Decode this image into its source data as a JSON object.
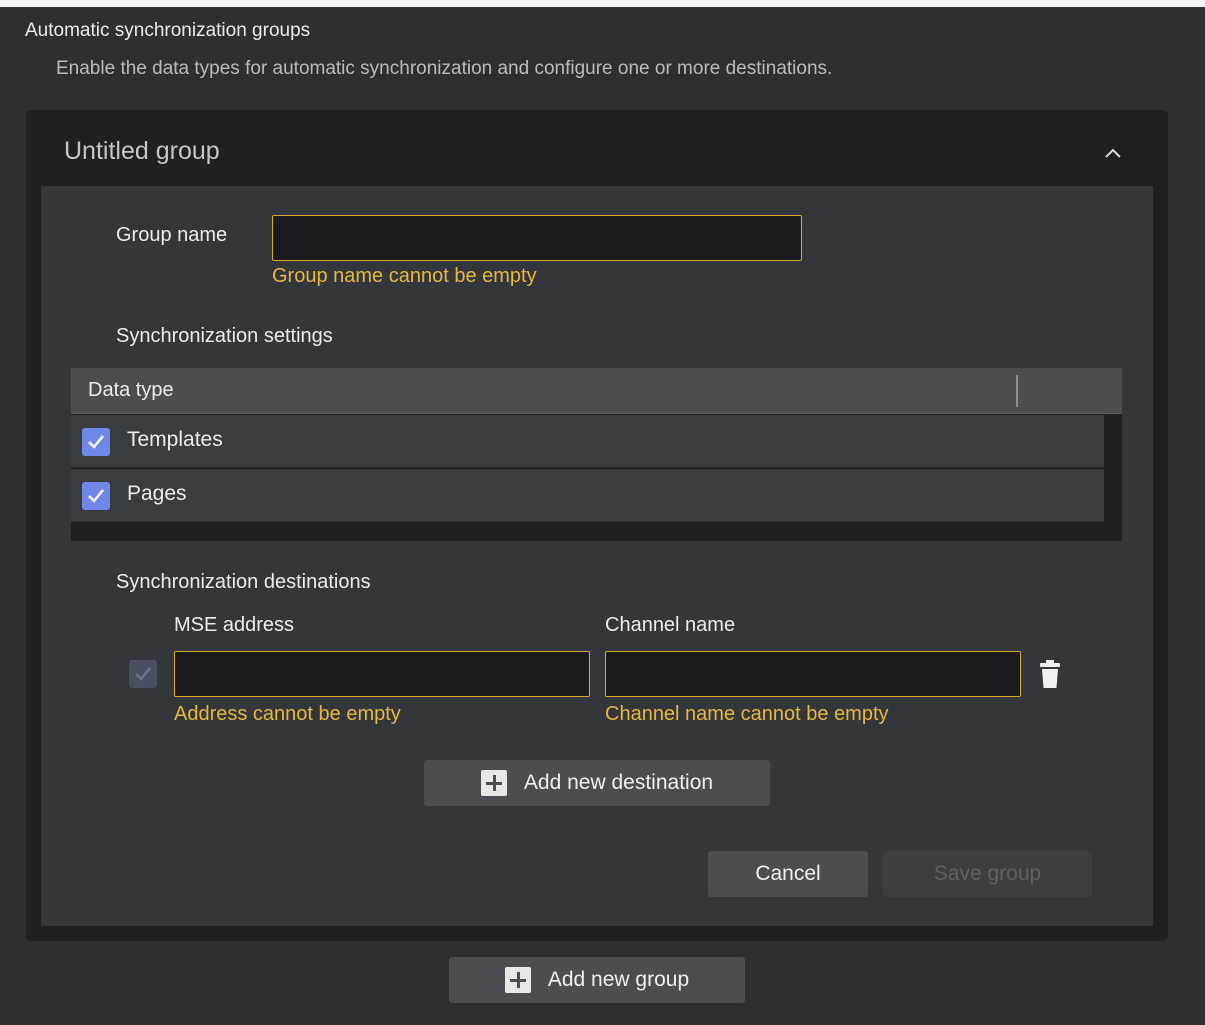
{
  "section": {
    "title": "Automatic synchronization groups",
    "description": "Enable the data types for automatic synchronization and configure one or more destinations."
  },
  "group": {
    "title": "Untitled group",
    "collapse_icon": "chevron-up-icon",
    "name_label": "Group name",
    "name_value": "",
    "name_error": "Group name cannot be empty",
    "sync_settings_label": "Synchronization settings",
    "data_table": {
      "header": "Data type",
      "rows": [
        {
          "label": "Templates",
          "checked": true
        },
        {
          "label": "Pages",
          "checked": true
        }
      ]
    },
    "destinations_label": "Synchronization destinations",
    "mse_address_label": "MSE address",
    "channel_name_label": "Channel name",
    "destination": {
      "enabled": true,
      "address_value": "",
      "channel_value": "",
      "address_error": "Address cannot be empty",
      "channel_error": "Channel name cannot be empty",
      "delete_icon": "trash-icon"
    },
    "add_destination_label": "Add new destination",
    "cancel_label": "Cancel",
    "save_label": "Save group"
  },
  "add_group_label": "Add new group",
  "colors": {
    "accent_checkbox": "#7088e8",
    "error": "#e8b83c",
    "background": "#2c2f33"
  }
}
